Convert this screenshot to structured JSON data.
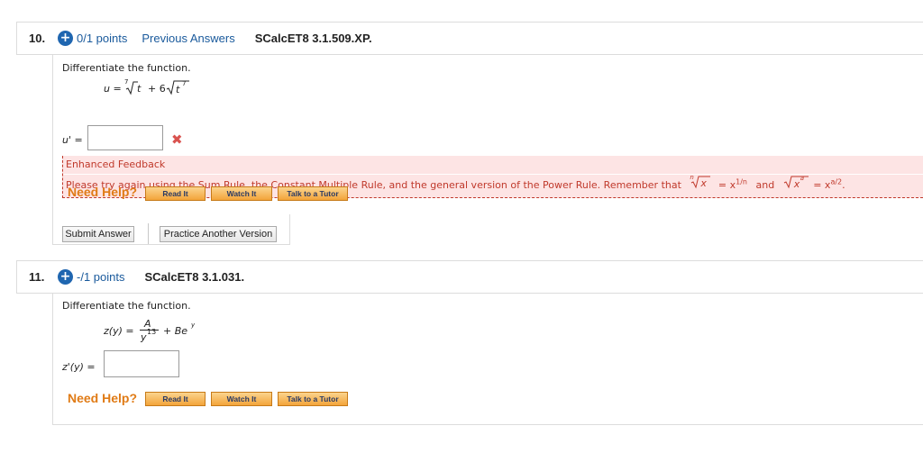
{
  "q10": {
    "number": "10.",
    "points": "0/1 points",
    "previous_answers": "Previous Answers",
    "id": "SCalcET8 3.1.509.XP.",
    "prompt": "Differentiate the function.",
    "func_lhs": "u =",
    "root_index": "7",
    "radicand1": "t",
    "plus": "+ 6",
    "radicand2_base": "t",
    "radicand2_exp": "7",
    "answer_label": "u' =",
    "answer_value": "",
    "wrong_mark": "✖",
    "feedback_title": "Enhanced Feedback",
    "feedback_text": "Please try again using the Sum Rule, the Constant Multiple Rule, and the general version of the Power Rule. Remember that",
    "fb_root_index": "n",
    "fb_radicand": "x",
    "fb_eq1": "= x",
    "fb_exp1": "1/n",
    "fb_and": "and",
    "fb_radicand2_base": "x",
    "fb_radicand2_exp": "a",
    "fb_eq2": "= x",
    "fb_exp2": "a/2",
    "fb_end": ".",
    "need_help": "Need Help?",
    "read_it": "Read It",
    "watch_it": "Watch It",
    "talk_tutor": "Talk to a Tutor",
    "submit": "Submit Answer",
    "practice": "Practice Another Version"
  },
  "q11": {
    "number": "11.",
    "points": "-/1 points",
    "id": "SCalcET8 3.1.031.",
    "prompt": "Differentiate the function.",
    "func_lhs": "z(y) =",
    "numerator": "A",
    "denom_base": "y",
    "denom_exp": "13",
    "plus_term": "+ Be",
    "plus_exp": "y",
    "answer_label": "z'(y) =",
    "answer_value": "",
    "need_help": "Need Help?",
    "read_it": "Read It",
    "watch_it": "Watch It",
    "talk_tutor": "Talk to a Tutor"
  },
  "colors": {
    "link_blue": "#1a5a9c",
    "badge_blue": "#1f66b0",
    "feedback_red": "#c0392b",
    "feedback_bg": "#fde4e4",
    "help_orange": "#e07b16"
  },
  "icons": {
    "plus_badge": "plus-circle-icon",
    "wrong": "close-x-icon"
  }
}
